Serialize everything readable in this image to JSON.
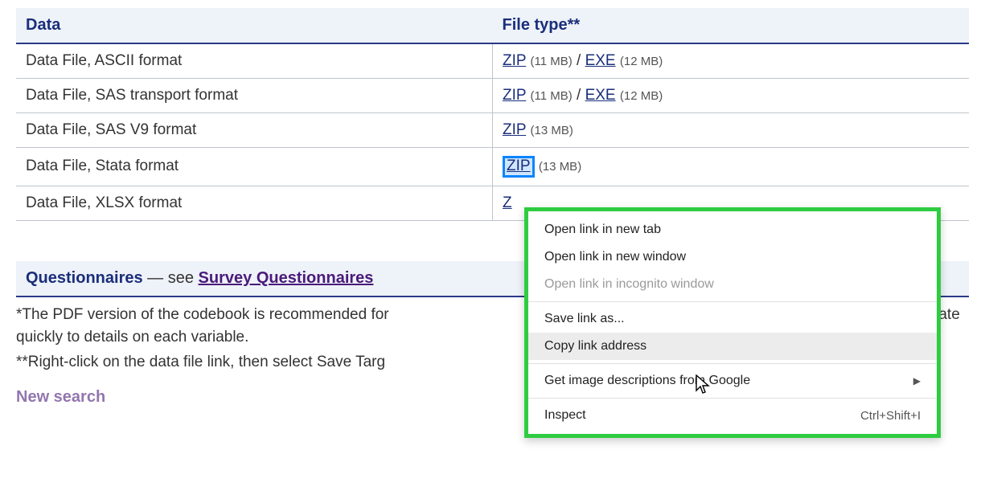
{
  "table": {
    "headers": {
      "data": "Data",
      "type": "File type**"
    },
    "rows": [
      {
        "label": "Data File, ASCII format",
        "links": [
          {
            "text": "ZIP",
            "size": "(11 MB)"
          },
          {
            "text": "EXE",
            "size": "(12 MB)"
          }
        ]
      },
      {
        "label": "Data File, SAS transport format",
        "links": [
          {
            "text": "ZIP",
            "size": "(11 MB)"
          },
          {
            "text": "EXE",
            "size": "(12 MB)"
          }
        ]
      },
      {
        "label": "Data File, SAS V9 format",
        "links": [
          {
            "text": "ZIP",
            "size": "(13 MB)"
          }
        ]
      },
      {
        "label": "Data File, Stata format",
        "highlight_first": true,
        "links": [
          {
            "text": "ZIP",
            "size": "(13 MB)"
          }
        ]
      },
      {
        "label": "Data File, XLSX format",
        "partial": true,
        "links": [
          {
            "text": "Z",
            "size": ""
          }
        ]
      }
    ]
  },
  "slash": "/",
  "questionnaires": {
    "title": "Questionnaires",
    "dash": "—",
    "see": "see",
    "link": "Survey Questionnaires"
  },
  "footnotes": {
    "line1_a": "*The PDF version of the codebook is recommended for ",
    "line1_b": "and lets you navigate quickly to details on each variable.",
    "line2": "**Right-click on the data file link, then select Save Targ"
  },
  "new_search": "New search",
  "context_menu": {
    "items": [
      {
        "label": "Open link in new tab",
        "type": "item"
      },
      {
        "label": "Open link in new window",
        "type": "item"
      },
      {
        "label": "Open link in incognito window",
        "type": "disabled"
      },
      {
        "type": "sep"
      },
      {
        "label": "Save link as...",
        "type": "item"
      },
      {
        "label": "Copy link address",
        "type": "hover"
      },
      {
        "type": "sep"
      },
      {
        "label": "Get image descriptions from Google",
        "type": "submenu"
      },
      {
        "type": "sep"
      },
      {
        "label": "Inspect",
        "type": "item",
        "shortcut": "Ctrl+Shift+I"
      }
    ]
  }
}
